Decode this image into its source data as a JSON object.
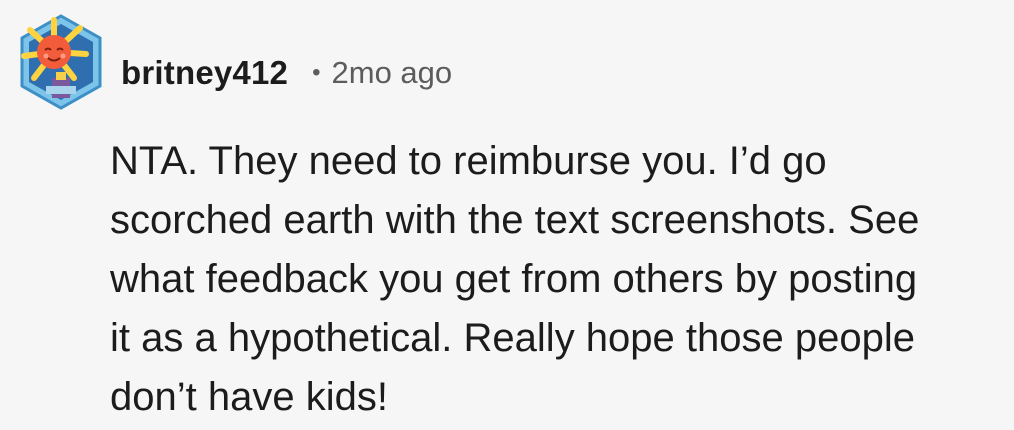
{
  "comment": {
    "username": "britney412",
    "separator": "•",
    "timestamp": "2mo ago",
    "avatar_icon": "snoo-avatar-icon",
    "body": "NTA. They need to reimburse you. I’d go\nscorched earth with the text screenshots. See\nwhat feedback you get from others by posting\nit as a hypothetical. Really hope those people\ndon’t have kids!"
  },
  "colors": {
    "background": "#f6f6f6",
    "text": "#1c1c1c",
    "meta": "#5c5c5c",
    "avatar_ring": "#41a9df",
    "avatar_face": "#f25c3a"
  }
}
